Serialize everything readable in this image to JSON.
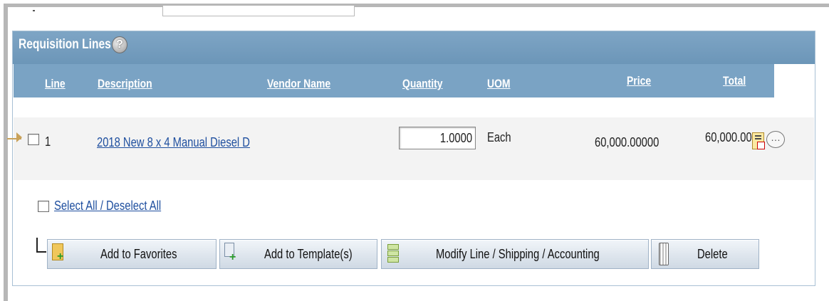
{
  "panel": {
    "title": "Requisition Lines",
    "help_icon": "?"
  },
  "columns": {
    "line": "Line",
    "description": "Description",
    "vendor": "Vendor Name",
    "quantity": "Quantity",
    "uom": "UOM",
    "price": "Price",
    "total": "Total"
  },
  "row": {
    "line_number": "1",
    "description": "2018 New 8 x 4 Manual Diesel D",
    "quantity": "1.0000",
    "uom": "Each",
    "price": "60,000.00000",
    "total": "60,000.000"
  },
  "select_all_label": "Select All / Deselect All",
  "buttons": {
    "add_favorites": "Add to Favorites",
    "add_template": "Add to Template(s)",
    "modify": "Modify Line / Shipping / Accounting",
    "delete": "Delete"
  },
  "icons": {
    "favorites": "favorites-icon",
    "template": "template-icon",
    "modify": "modify-icon",
    "delete": "trash-icon",
    "details": "line-details-icon",
    "comment": "comment-icon"
  }
}
